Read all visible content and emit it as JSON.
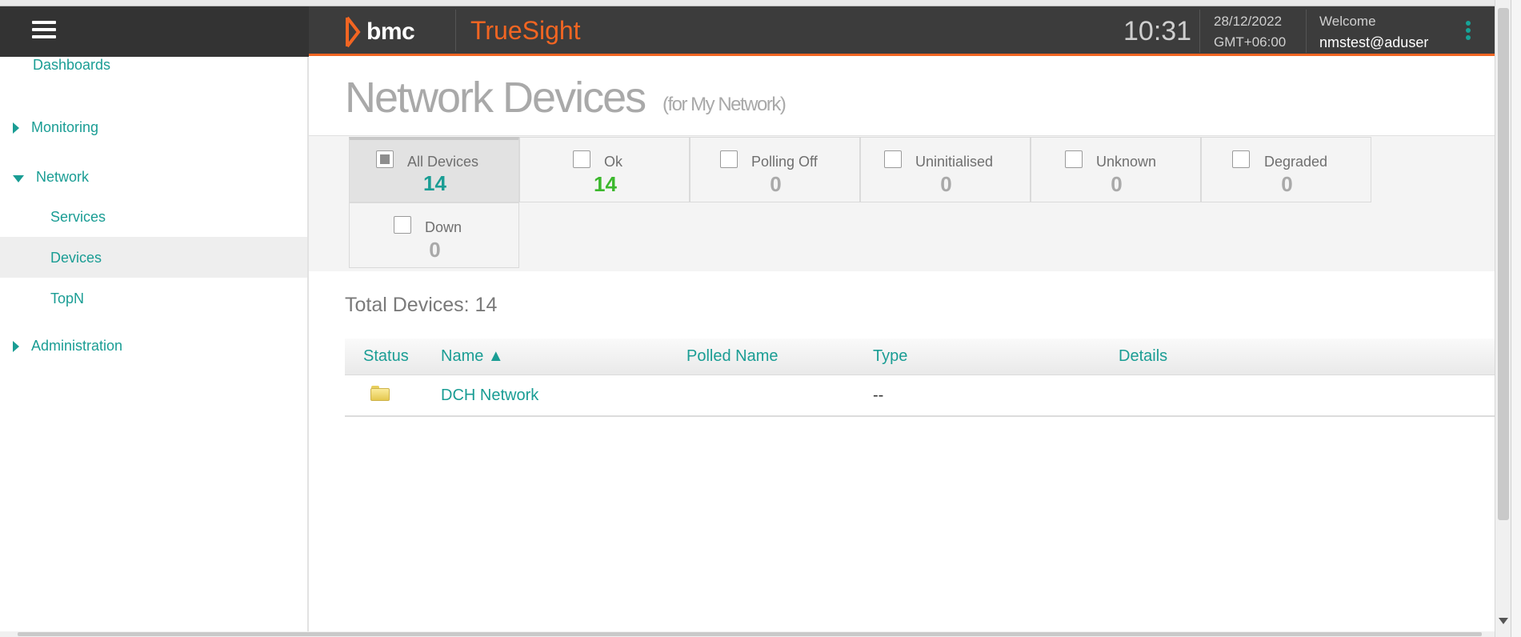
{
  "app": {
    "brand": "bmc",
    "product": "TrueSight",
    "time": "10:31",
    "date": "28/12/2022",
    "timezone": "GMT+06:00",
    "welcome_label": "Welcome",
    "user": "nmstest@aduser",
    "accent_color": "#f26522",
    "link_color": "#1a9d94"
  },
  "sidebar": {
    "items": [
      {
        "label": "Dashboards",
        "expander": "none"
      },
      {
        "label": "Monitoring",
        "expander": "collapsed"
      },
      {
        "label": "Network",
        "expander": "expanded"
      },
      {
        "label": "Services",
        "expander": "none"
      },
      {
        "label": "Devices",
        "expander": "none",
        "active": true
      },
      {
        "label": "TopN",
        "expander": "none"
      },
      {
        "label": "Administration",
        "expander": "collapsed"
      }
    ]
  },
  "page": {
    "title": "Network Devices",
    "subtitle": "(for My Network)"
  },
  "filters": [
    {
      "label": "All Devices",
      "count": "14",
      "color": "#1a9d94",
      "selected": true
    },
    {
      "label": "Ok",
      "count": "14",
      "color": "#3cb82d",
      "selected": false
    },
    {
      "label": "Polling Off",
      "count": "0",
      "color": "#a9a9a9",
      "selected": false
    },
    {
      "label": "Uninitialised",
      "count": "0",
      "color": "#a9a9a9",
      "selected": false
    },
    {
      "label": "Unknown",
      "count": "0",
      "color": "#a9a9a9",
      "selected": false
    },
    {
      "label": "Degraded",
      "count": "0",
      "color": "#a9a9a9",
      "selected": false
    },
    {
      "label": "Down",
      "count": "0",
      "color": "#a9a9a9",
      "selected": false
    }
  ],
  "summary": {
    "total_label": "Total Devices: 14"
  },
  "table": {
    "columns": [
      "Status",
      "Name ▲",
      "Polled Name",
      "Type",
      "Details"
    ],
    "rows": [
      {
        "status_icon": "folder-icon",
        "name": "DCH Network",
        "polled_name": "",
        "type": "--",
        "details": ""
      }
    ]
  }
}
